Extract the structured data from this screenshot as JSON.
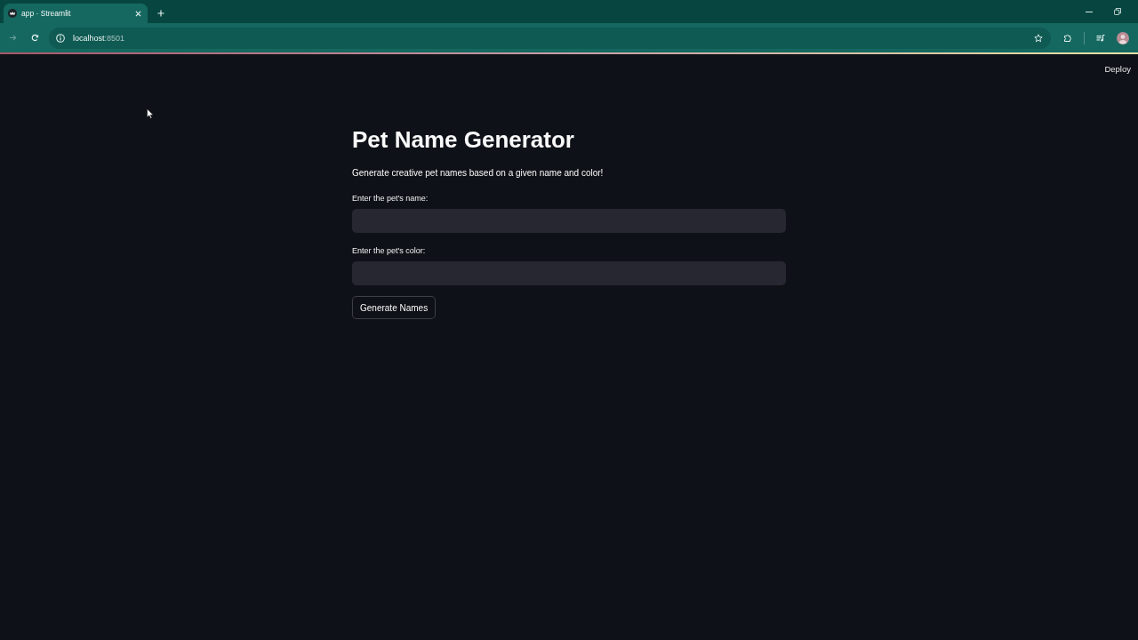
{
  "browser": {
    "tabs": [
      {
        "title": "app · Streamlit",
        "selected": true
      }
    ],
    "forward": {
      "disabled": true
    },
    "address": {
      "host": "localhost",
      "port": ":8501"
    }
  },
  "app": {
    "header": {
      "deploy": "Deploy"
    },
    "title": "Pet Name Generator",
    "description": "Generate creative pet names based on a given name and color!",
    "fields": [
      {
        "label": "Enter the pet's name:"
      },
      {
        "label": "Enter the pet's color:"
      }
    ],
    "button": "Generate Names"
  }
}
